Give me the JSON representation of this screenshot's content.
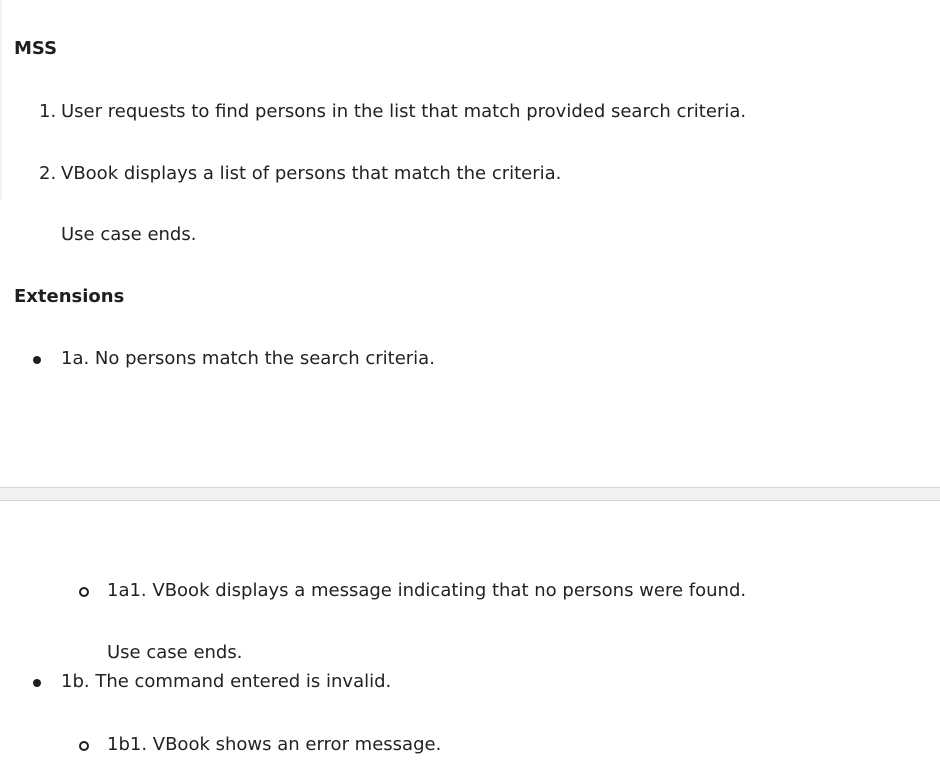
{
  "sections": {
    "mss_heading": "MSS",
    "extensions_heading": "Extensions"
  },
  "mss_steps": [
    {
      "number": "1.",
      "text": "User requests to find persons in the list that match provided search criteria."
    },
    {
      "number": "2.",
      "text": "VBook displays a list of persons that match the criteria."
    }
  ],
  "mss_end": "Use case ends.",
  "extensions": [
    {
      "text": "1a. No persons match the search criteria.",
      "sub": "1a1. VBook displays a message indicating that no persons were found.",
      "end": "Use case ends."
    },
    {
      "text": "1b. The command entered is invalid.",
      "sub": "1b1. VBook shows an error message."
    }
  ]
}
